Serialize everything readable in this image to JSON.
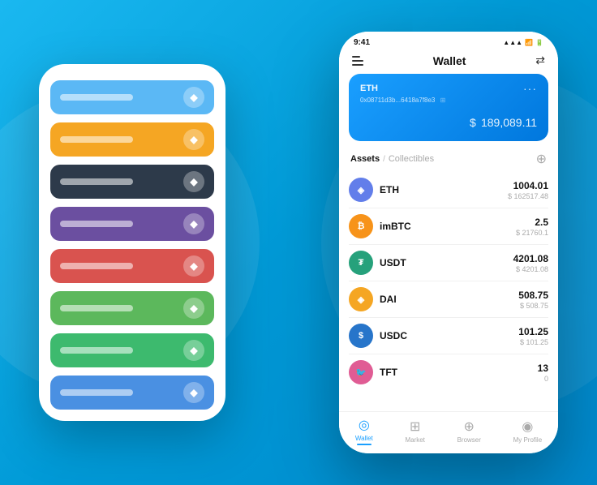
{
  "background": {
    "gradient_start": "#1ab8f0",
    "gradient_end": "#0088cc"
  },
  "back_phone": {
    "wallet_cards": [
      {
        "id": "card-1",
        "color": "#5bb8f5",
        "icon": "◆"
      },
      {
        "id": "card-2",
        "color": "#f5a623",
        "icon": "◆"
      },
      {
        "id": "card-3",
        "color": "#2d3a4a",
        "icon": "◆"
      },
      {
        "id": "card-4",
        "color": "#6b4fa0",
        "icon": "◆"
      },
      {
        "id": "card-5",
        "color": "#d9534f",
        "icon": "◆"
      },
      {
        "id": "card-6",
        "color": "#5cb85c",
        "icon": "◆"
      },
      {
        "id": "card-7",
        "color": "#3dba6e",
        "icon": "◆"
      },
      {
        "id": "card-8",
        "color": "#4a90e2",
        "icon": "◆"
      }
    ]
  },
  "front_phone": {
    "status_bar": {
      "time": "9:41",
      "signal": "●●●",
      "wifi": "▲",
      "battery": "▮▮▮"
    },
    "header": {
      "title": "Wallet",
      "menu_icon": "menu",
      "scan_icon": "scan"
    },
    "eth_card": {
      "name": "ETH",
      "address": "0x08711d3b...6418a7f8e3",
      "dots": "···",
      "balance": "189,089.11",
      "currency_symbol": "$"
    },
    "assets": {
      "active_tab": "Assets",
      "inactive_tab": "Collectibles",
      "separator": "/"
    },
    "tokens": [
      {
        "symbol": "ETH",
        "name": "ETH",
        "icon_color": "#627eea",
        "icon_text": "◈",
        "amount": "1004.01",
        "usd": "$ 162517.48"
      },
      {
        "symbol": "imBTC",
        "name": "imBTC",
        "icon_color": "#f7931a",
        "icon_text": "₿",
        "amount": "2.5",
        "usd": "$ 21760.1"
      },
      {
        "symbol": "USDT",
        "name": "USDT",
        "icon_color": "#26a17b",
        "icon_text": "₮",
        "amount": "4201.08",
        "usd": "$ 4201.08"
      },
      {
        "symbol": "DAI",
        "name": "DAI",
        "icon_color": "#f5a623",
        "icon_text": "◈",
        "amount": "508.75",
        "usd": "$ 508.75"
      },
      {
        "symbol": "USDC",
        "name": "USDC",
        "icon_color": "#2775ca",
        "icon_text": "$",
        "amount": "101.25",
        "usd": "$ 101.25"
      },
      {
        "symbol": "TFT",
        "name": "TFT",
        "icon_color": "#e05c94",
        "icon_text": "🐦",
        "amount": "13",
        "usd": "0"
      }
    ],
    "bottom_nav": [
      {
        "id": "wallet",
        "label": "Wallet",
        "icon": "◎",
        "active": true
      },
      {
        "id": "market",
        "label": "Market",
        "icon": "⊞",
        "active": false
      },
      {
        "id": "browser",
        "label": "Browser",
        "icon": "⊕",
        "active": false
      },
      {
        "id": "profile",
        "label": "My Profile",
        "icon": "◉",
        "active": false
      }
    ]
  }
}
